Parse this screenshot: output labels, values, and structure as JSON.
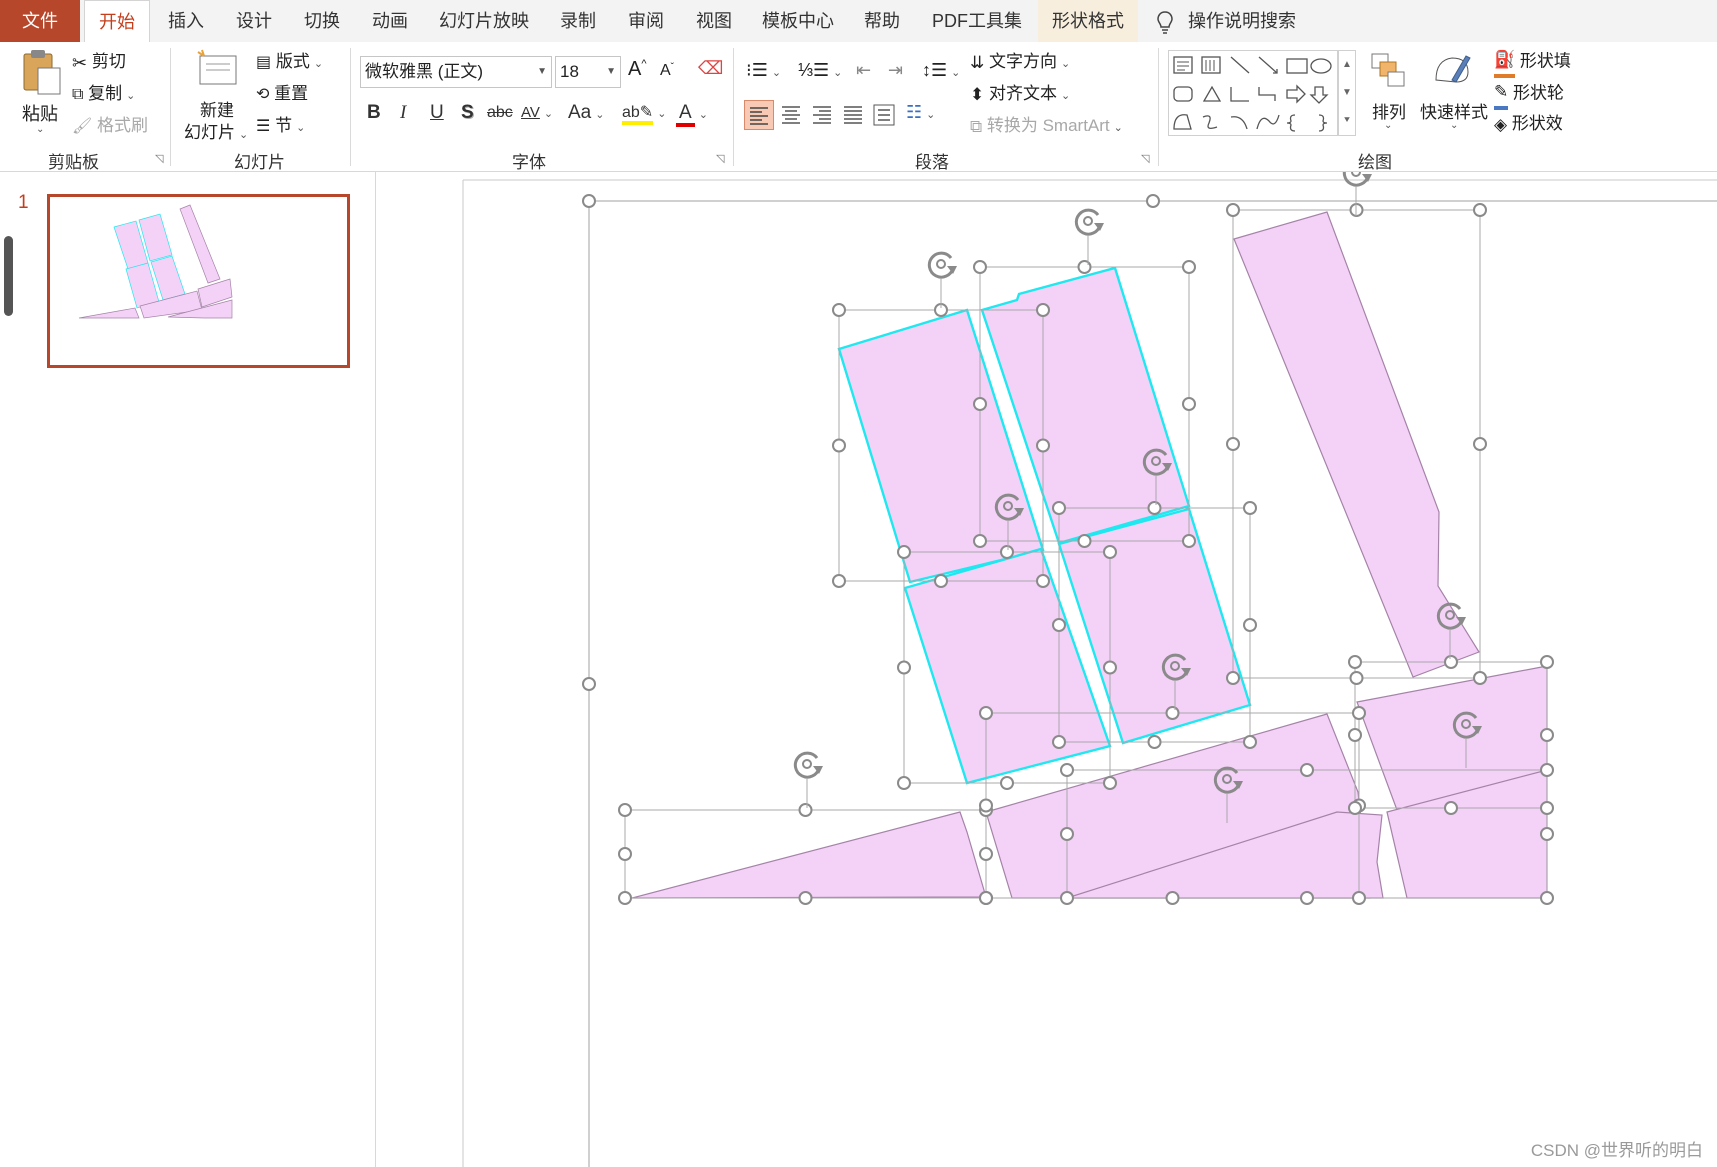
{
  "tabs": {
    "file": "文件",
    "home": "开始",
    "insert": "插入",
    "design": "设计",
    "transitions": "切换",
    "animations": "动画",
    "slideshow": "幻灯片放映",
    "record": "录制",
    "review": "审阅",
    "view": "视图",
    "templates": "模板中心",
    "help": "帮助",
    "pdf": "PDF工具集",
    "shape_format": "形状格式",
    "search": "操作说明搜索"
  },
  "ribbon": {
    "clipboard": {
      "paste": "粘贴",
      "cut": "剪切",
      "copy": "复制",
      "format_painter": "格式刷",
      "group_label": "剪贴板"
    },
    "slides": {
      "new_slide_line1": "新建",
      "new_slide_line2": "幻灯片",
      "layout": "版式",
      "reset": "重置",
      "section": "节",
      "group_label": "幻灯片"
    },
    "font": {
      "font_name": "微软雅黑 (正文)",
      "font_size": "18",
      "group_label": "字体",
      "bold": "B",
      "italic": "I",
      "underline": "U",
      "shadow": "S",
      "strike": "abc",
      "spacing": "AV",
      "case": "Aa"
    },
    "paragraph": {
      "text_direction": "文字方向",
      "align_text": "对齐文本",
      "smartart": "转换为 SmartArt",
      "group_label": "段落"
    },
    "drawing": {
      "arrange": "排列",
      "quick_styles": "快速样式",
      "shape_fill": "形状填",
      "shape_outline": "形状轮",
      "shape_effects": "形状效",
      "group_label": "绘图"
    }
  },
  "thumbnails": {
    "slide_number": "1"
  },
  "watermark": "CSDN @世界听的明白",
  "colors": {
    "accent": "#b7472a",
    "active_tab_text": "#c43e1c",
    "shape_fill": "#f4d1f7",
    "shape_stroke": "#a583a8",
    "selection_outline": "#1fe8f0",
    "handle": "#8a8a8a"
  }
}
